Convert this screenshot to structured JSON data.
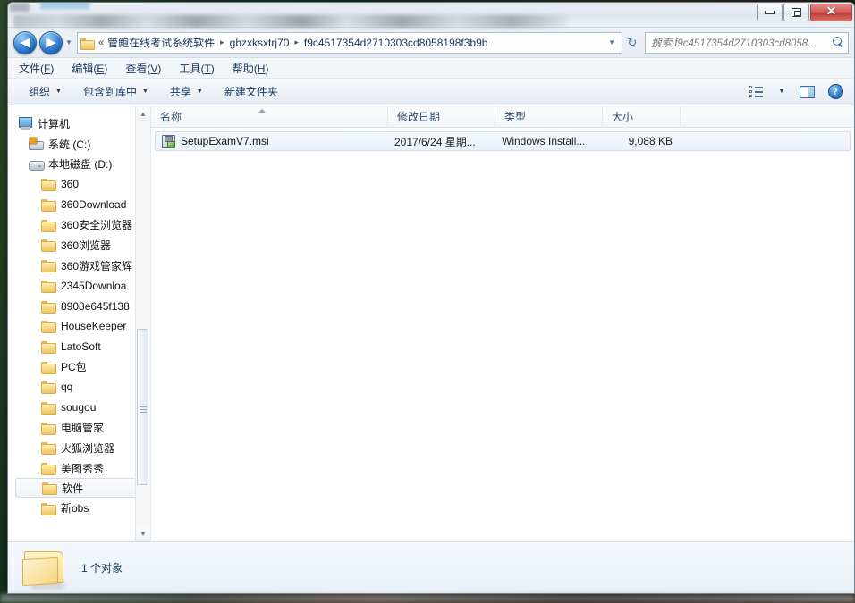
{
  "window": {
    "title_blurred": true,
    "controls": {
      "minimize": "–",
      "maximize": "□",
      "close": "✕"
    }
  },
  "address_bar": {
    "back_glyph": "◀",
    "forward_glyph": "▶",
    "history_caret": "▼",
    "overflow_chevron": "«",
    "separator": "▸",
    "crumbs": [
      "管鲍在线考试系统软件",
      "gbzxksxtrj70",
      "f9c4517354d2710303cd8058198f3b9b"
    ],
    "dropdown_caret": "▼",
    "refresh_glyph": "↻"
  },
  "search": {
    "placeholder": "搜索 f9c4517354d2710303cd8058...",
    "icon": "search-icon"
  },
  "menubar": {
    "items": [
      {
        "text": "文件",
        "key": "F"
      },
      {
        "text": "编辑",
        "key": "E"
      },
      {
        "text": "查看",
        "key": "V"
      },
      {
        "text": "工具",
        "key": "T"
      },
      {
        "text": "帮助",
        "key": "H"
      }
    ]
  },
  "toolbar": {
    "organize": "组织",
    "include_in_library": "包含到库中",
    "share": "共享",
    "new_folder": "新建文件夹",
    "caret": "▼",
    "views_icon": "views-icon",
    "preview_pane_icon": "preview-pane-icon",
    "help_icon": "?"
  },
  "nav_pane": {
    "items": [
      {
        "label": "计算机",
        "icon": "computer-icon",
        "level": 0,
        "selected": false
      },
      {
        "label": "系统 (C:)",
        "icon": "system-drive-icon",
        "level": 1,
        "selected": false
      },
      {
        "label": "本地磁盘 (D:)",
        "icon": "drive-icon",
        "level": 1,
        "selected": false
      },
      {
        "label": "360",
        "icon": "folder-icon",
        "level": 2,
        "selected": false
      },
      {
        "label": "360Download",
        "icon": "folder-icon",
        "level": 2,
        "selected": false
      },
      {
        "label": "360安全浏览器",
        "icon": "folder-icon",
        "level": 2,
        "selected": false
      },
      {
        "label": "360浏览器",
        "icon": "folder-icon",
        "level": 2,
        "selected": false
      },
      {
        "label": "360游戏管家辉",
        "icon": "folder-icon",
        "level": 2,
        "selected": false
      },
      {
        "label": "2345Downloa",
        "icon": "folder-icon",
        "level": 2,
        "selected": false
      },
      {
        "label": "8908e645f138",
        "icon": "folder-icon",
        "level": 2,
        "selected": false
      },
      {
        "label": "HouseKeeper",
        "icon": "folder-icon",
        "level": 2,
        "selected": false
      },
      {
        "label": "LatoSoft",
        "icon": "folder-icon",
        "level": 2,
        "selected": false
      },
      {
        "label": "PC包",
        "icon": "folder-icon",
        "level": 2,
        "selected": false
      },
      {
        "label": "qq",
        "icon": "folder-icon",
        "level": 2,
        "selected": false
      },
      {
        "label": "sougou",
        "icon": "folder-icon",
        "level": 2,
        "selected": false
      },
      {
        "label": "电脑管家",
        "icon": "folder-icon",
        "level": 2,
        "selected": false
      },
      {
        "label": "火狐浏览器",
        "icon": "folder-icon",
        "level": 2,
        "selected": false
      },
      {
        "label": "美图秀秀",
        "icon": "folder-icon",
        "level": 2,
        "selected": false
      },
      {
        "label": "软件",
        "icon": "folder-icon",
        "level": 2,
        "selected": true
      },
      {
        "label": "新obs",
        "icon": "folder-icon",
        "level": 2,
        "selected": false
      }
    ],
    "scrollbar": {
      "up_arrow": "▲",
      "down_arrow": "▼"
    }
  },
  "file_list": {
    "columns": [
      {
        "key": "name",
        "label": "名称",
        "sorted": "asc"
      },
      {
        "key": "date",
        "label": "修改日期",
        "sorted": ""
      },
      {
        "key": "type",
        "label": "类型",
        "sorted": ""
      },
      {
        "key": "size",
        "label": "大小",
        "sorted": ""
      }
    ],
    "rows": [
      {
        "name": "SetupExamV7.msi",
        "date": "2017/6/24 星期...",
        "type": "Windows Install...",
        "size": "9,088 KB",
        "icon": "msi-installer-icon",
        "selected": true
      }
    ]
  },
  "details_pane": {
    "icon": "folder-large-icon",
    "text": "1 个对象"
  },
  "colors": {
    "accent_blue": "#2f6fad",
    "crumb_text": "#13335e",
    "selection_fill": "#e8f1fa",
    "selection_border": "#cfdfee",
    "close_button": "#bc3c34",
    "folder_yellow": "#f8da88"
  }
}
